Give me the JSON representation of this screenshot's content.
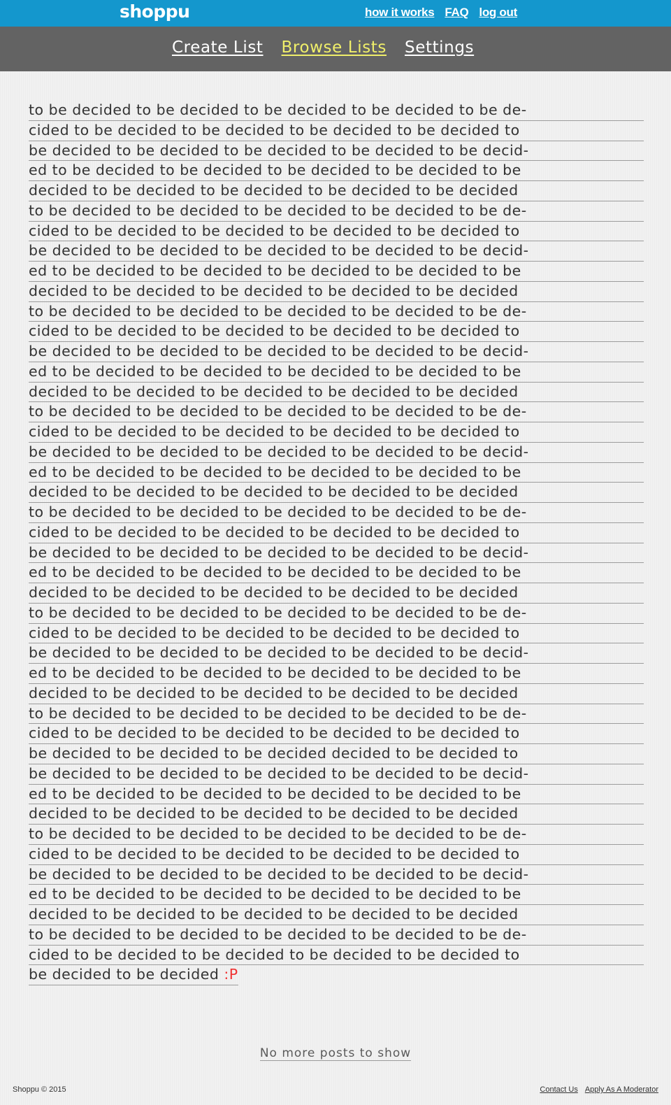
{
  "header": {
    "brand": "shoppu",
    "links": [
      "how it works",
      "FAQ",
      "log out"
    ]
  },
  "nav": {
    "items": [
      "Create List",
      "Browse Lists",
      "Settings"
    ],
    "active": "Browse Lists"
  },
  "post": {
    "lines": [
      "to be decided to be decided to be decided to be decided to be de-",
      "cided to be decided to be decided to be decided to be decided to",
      "be decided to be decided to be decided to be decided to be decid-",
      "ed to be decided to be decided to be decided to be decided to be",
      "decided to be decided to be decided to be decided to be decided",
      "to be decided to be decided to be decided to be decided to be de-",
      "cided to be decided to be decided to be decided to be decided to",
      "be decided to be decided to be decided to be decided to be decid-",
      "ed to be decided to be decided to be decided to be decided to be",
      "decided to be decided to be decided to be decided to be decided",
      "to be decided to be decided to be decided to be decided to be de-",
      "cided to be decided to be decided to be decided to be decided to",
      "be decided to be decided to be decided to be decided to be decid-",
      "ed to be decided to be decided to be decided to be decided to be",
      "decided to be decided to be decided to be decided to be decided",
      "to be decided to be decided to be decided to be decided to be de-",
      "cided to be decided to be decided to be decided to be decided to",
      "be decided to be decided to be decided to be decided to be decid-",
      "ed to be decided to be decided to be decided to be decided to be",
      "decided to be decided to be decided to be decided to be decided",
      "to be decided to be decided to be decided to be decided to be de-",
      "cided to be decided to be decided to be decided to be decided to",
      "be decided to be decided to be decided to be decided to be decid-",
      "ed to be decided to be decided to be decided to be decided to be",
      "decided to be decided to be decided to be decided to be decided",
      "to be decided to be decided to be decided to be decided to be de-",
      "cided to be decided to be decided to be decided to be decided to",
      "be decided to be decided to be decided to be decided to be decid-",
      "ed to be decided to be decided to be decided to be decided to be",
      "decided to be decided to be decided to be decided to be decided",
      "to be decided to be decided to be decided to be decided to be de-",
      "cided to be decided to be decided to be decided to be decided to",
      "be decided to be decided to be decided  decided to be decided to",
      "be decided to be decided to be decided to be decided to be decid-",
      "ed to be decided to be decided to be decided to be decided to be",
      "decided to be decided to be decided to be decided to be decided",
      "to be decided to be decided to be decided to be decided to be de-",
      "cided to be decided to be decided to be decided to be decided to",
      "be decided to be decided to be decided to be decided to be decid-",
      "ed to be decided to be decided to be decided to be decided to be",
      "decided to be decided to be decided  to be decided to be decided",
      "to be decided to be decided to be decided to be decided to be de-",
      "cided to be decided to be decided to be decided to be decided to"
    ],
    "last_line": "be decided to be decided ",
    "emoticon": ":P"
  },
  "end_note": "No more posts to show",
  "footer": {
    "copyright": "Shoppu © 2015",
    "links": [
      "Contact Us",
      "Apply As A Moderator"
    ]
  }
}
